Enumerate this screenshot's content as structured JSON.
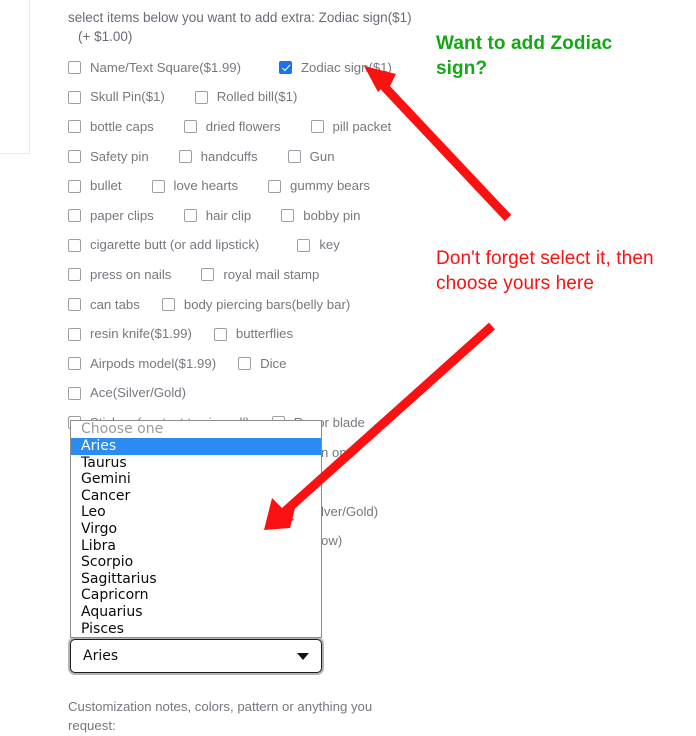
{
  "form": {
    "intro_text": "select items below you want to add extra:  Zodiac sign($1)",
    "intro_amount": "(+ $1.00)",
    "footer_note": "Customization notes, colors, pattern or anything you request:",
    "rows": [
      [
        {
          "label": "Name/Text Square($1.99)",
          "checked": false
        },
        {
          "label": "Zodiac sign($1)",
          "checked": true
        }
      ],
      [
        {
          "label": "Skull Pin($1)",
          "checked": false
        },
        {
          "label": "Rolled bill($1)",
          "checked": false
        }
      ],
      [
        {
          "label": "bottle caps",
          "checked": false
        },
        {
          "label": "dried flowers",
          "checked": false
        },
        {
          "label": "pill packet",
          "checked": false
        }
      ],
      [
        {
          "label": "Safety pin",
          "checked": false
        },
        {
          "label": "handcuffs",
          "checked": false
        },
        {
          "label": "Gun",
          "checked": false
        }
      ],
      [
        {
          "label": "bullet",
          "checked": false
        },
        {
          "label": "love hearts",
          "checked": false
        },
        {
          "label": "gummy bears",
          "checked": false
        }
      ],
      [
        {
          "label": "paper clips",
          "checked": false
        },
        {
          "label": "hair clip",
          "checked": false
        },
        {
          "label": "bobby pin",
          "checked": false
        }
      ],
      [
        {
          "label": "cigarette butt (or add lipstick)",
          "checked": false
        },
        {
          "label": "key",
          "checked": false
        }
      ],
      [
        {
          "label": "press on nails",
          "checked": false
        },
        {
          "label": "royal mail stamp",
          "checked": false
        }
      ],
      [
        {
          "label": "can tabs",
          "checked": false
        },
        {
          "label": "body piercing bars(belly bar)",
          "checked": false
        }
      ],
      [
        {
          "label": "resin knife($1.99)",
          "checked": false
        },
        {
          "label": "butterflies",
          "checked": false
        }
      ],
      [
        {
          "label": "Airpods model($1.99)",
          "checked": false
        },
        {
          "label": "Dice",
          "checked": false
        }
      ],
      [
        {
          "label": "Ace(Silver/Gold)",
          "checked": false
        }
      ],
      [
        {
          "label": "Stickers(contact to view all)",
          "checked": false
        },
        {
          "label": "Razor blade",
          "checked": false
        }
      ]
    ],
    "obscured_rows": [
      {
        "label": "n on"
      },
      {
        "label": "lver/Gold)"
      },
      {
        "label": "ow)"
      }
    ]
  },
  "zodiac_select": {
    "selected_value": "Aries",
    "caret": "chevron-down-icon",
    "options": [
      {
        "label": "Choose one",
        "state": "placeholder"
      },
      {
        "label": "Aries",
        "state": "selected"
      },
      {
        "label": "Taurus",
        "state": "normal"
      },
      {
        "label": "Gemini",
        "state": "normal"
      },
      {
        "label": "Cancer",
        "state": "normal"
      },
      {
        "label": "Leo",
        "state": "normal"
      },
      {
        "label": "Virgo",
        "state": "normal"
      },
      {
        "label": "Libra",
        "state": "normal"
      },
      {
        "label": "Scorpio",
        "state": "normal"
      },
      {
        "label": "Sagittarius",
        "state": "normal"
      },
      {
        "label": "Capricorn",
        "state": "normal"
      },
      {
        "label": "Aquarius",
        "state": "normal"
      },
      {
        "label": "Pisces",
        "state": "normal"
      }
    ]
  },
  "annotations": {
    "green_note": "Want to add Zodiac sign?",
    "red_note": "Don't forget select it, then choose yours here"
  },
  "colors": {
    "checkbox_checked": "#1a73e8",
    "dropdown_highlight": "#2a8bf2",
    "annotation_green": "#14a814",
    "annotation_red": "#fb1111",
    "label_text": "#77777f"
  }
}
